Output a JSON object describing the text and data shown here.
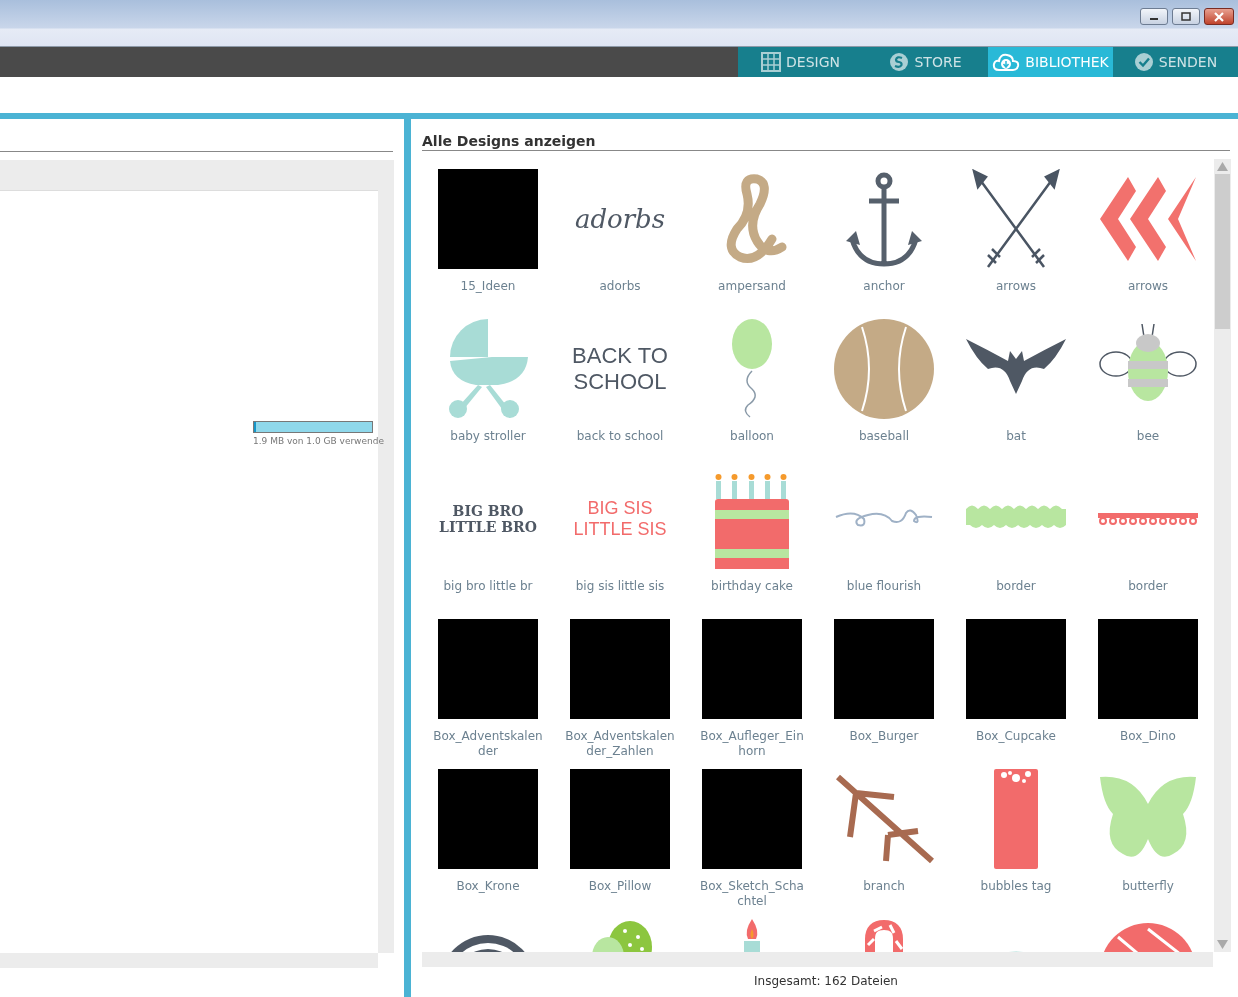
{
  "nav_tabs": [
    {
      "label": "DESIGN",
      "kind": "grid",
      "selected": false
    },
    {
      "label": "STORE",
      "kind": "s",
      "selected": false
    },
    {
      "label": "BIBLIOTHEK",
      "kind": "cloud",
      "selected": true
    },
    {
      "label": "SENDEN",
      "kind": "check",
      "selected": false
    }
  ],
  "storage": {
    "level": 0.02,
    "reading": "1.9 MB von 1.0 GB verwende"
  },
  "library": {
    "title": "Alle Designs anzeigen",
    "designs": [
      {
        "kind": "black",
        "label": "15_Ideen"
      },
      {
        "kind": "script",
        "art_lines": [
          "adorbs"
        ],
        "label": "adorbs"
      },
      {
        "kind": "ampersand",
        "label": "ampersand"
      },
      {
        "kind": "anchor",
        "label": "anchor"
      },
      {
        "kind": "arrows",
        "label": "arrows"
      },
      {
        "kind": "chevrons",
        "label": "arrows"
      },
      {
        "kind": "stroller",
        "label": "baby stroller"
      },
      {
        "kind": "chalk",
        "art_lines": [
          "BACK TO",
          "SCHOOL"
        ],
        "label": "back to school"
      },
      {
        "kind": "balloon",
        "label": "balloon"
      },
      {
        "kind": "baseball",
        "label": "baseball"
      },
      {
        "kind": "bat",
        "label": "bat"
      },
      {
        "kind": "bee",
        "label": "bee"
      },
      {
        "kind": "slab",
        "art_lines": [
          "BIG BRO",
          "LITTLE BRO"
        ],
        "label": "big bro little br"
      },
      {
        "kind": "chalkred",
        "art_lines": [
          "BIG SIS",
          "LITTLE SIS"
        ],
        "label": "big sis little sis"
      },
      {
        "kind": "cake",
        "label": "birthday cake"
      },
      {
        "kind": "flourish",
        "label": "blue flourish"
      },
      {
        "kind": "scallop",
        "label": "border"
      },
      {
        "kind": "dots",
        "label": "border"
      },
      {
        "kind": "black",
        "label": "Box_Adventskalender"
      },
      {
        "kind": "black",
        "label": "Box_Adventskalender_Zahlen"
      },
      {
        "kind": "black",
        "label": "Box_Aufleger_Einhorn"
      },
      {
        "kind": "black",
        "label": "Box_Burger"
      },
      {
        "kind": "black",
        "label": "Box_Cupcake"
      },
      {
        "kind": "black",
        "label": "Box_Dino"
      },
      {
        "kind": "black",
        "label": "Box_Krone"
      },
      {
        "kind": "black",
        "label": "Box_Pillow"
      },
      {
        "kind": "black",
        "label": "Box_Sketch_Schachtel"
      },
      {
        "kind": "branch",
        "label": "branch"
      },
      {
        "kind": "tag",
        "label": "bubbles tag"
      },
      {
        "kind": "butterfly",
        "label": "butterfly"
      },
      {
        "kind": "ring"
      },
      {
        "kind": "eggs"
      },
      {
        "kind": "candle"
      },
      {
        "kind": "cane"
      },
      {
        "kind": "peace"
      },
      {
        "kind": "ball"
      }
    ],
    "footer": "Insgesamt: 162 Dateien"
  }
}
